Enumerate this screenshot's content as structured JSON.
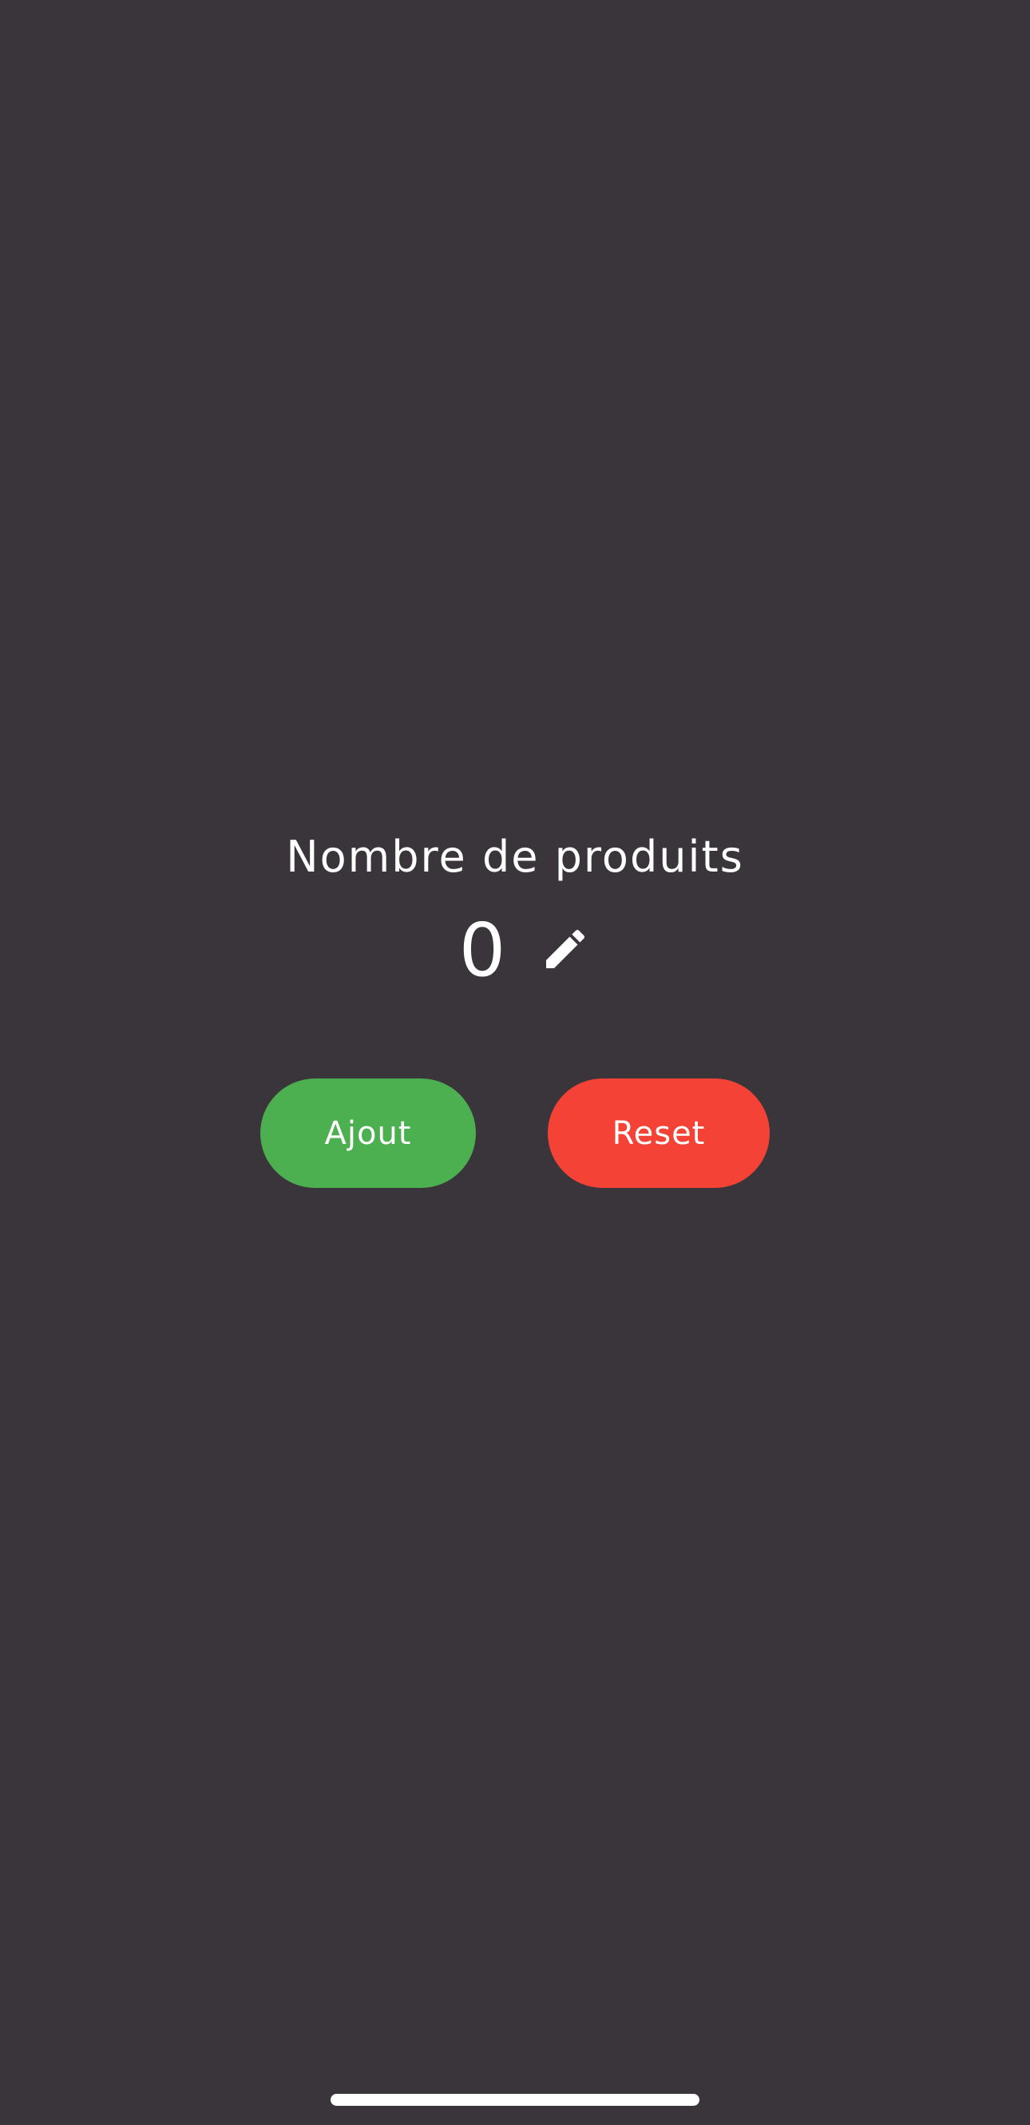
{
  "counter": {
    "title": "Nombre de produits",
    "value": "0"
  },
  "actions": {
    "add_label": "Ajout",
    "reset_label": "Reset"
  },
  "icons": {
    "edit": "pencil-icon"
  },
  "colors": {
    "background": "#3a353b",
    "add_button": "#4caf50",
    "reset_button": "#f44336",
    "text": "#ffffff"
  }
}
